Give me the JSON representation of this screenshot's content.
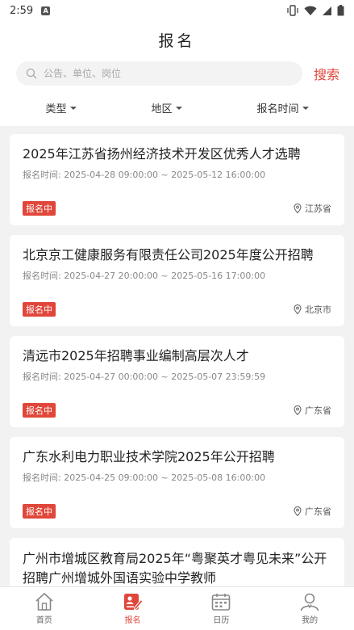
{
  "status_bar": {
    "time": "2:59",
    "sim_label": "A"
  },
  "header": {
    "title": "报名"
  },
  "search": {
    "placeholder": "公告、单位、岗位",
    "button_label": "搜索"
  },
  "filters": [
    {
      "label": "类型"
    },
    {
      "label": "地区"
    },
    {
      "label": "报名时间"
    }
  ],
  "cards": [
    {
      "title": "2025年江苏省扬州经济技术开发区优秀人才选聘",
      "time": "报名时间:  2025-04-28 09:00:00 ~ 2025-05-12 16:00:00",
      "status": "报名中",
      "location": "江苏省"
    },
    {
      "title": "北京京工健康服务有限责任公司2025年度公开招聘",
      "time": "报名时间:  2025-04-27 20:00:00 ~ 2025-05-16 17:00:00",
      "status": "报名中",
      "location": "北京市"
    },
    {
      "title": "清远市2025年招聘事业编制高层次人才",
      "time": "报名时间:  2025-04-27 00:00:00 ~ 2025-05-07 23:59:59",
      "status": "报名中",
      "location": "广东省"
    },
    {
      "title": "广东水利电力职业技术学院2025年公开招聘",
      "time": "报名时间:  2025-04-25 09:00:00 ~ 2025-05-08 16:00:00",
      "status": "报名中",
      "location": "广东省"
    },
    {
      "title": "广州市增城区教育局2025年“粤聚英才粤见未来”公开招聘广州增城外国语实验中学教师"
    }
  ],
  "tabbar": {
    "items": [
      {
        "label": "首页",
        "icon": "home-icon"
      },
      {
        "label": "报名",
        "icon": "signup-icon"
      },
      {
        "label": "日历",
        "icon": "calendar-icon"
      },
      {
        "label": "我的",
        "icon": "profile-icon"
      }
    ],
    "active_color": "#e0473a"
  },
  "colors": {
    "accent": "#e0473a",
    "background": "#f2f2f2"
  }
}
